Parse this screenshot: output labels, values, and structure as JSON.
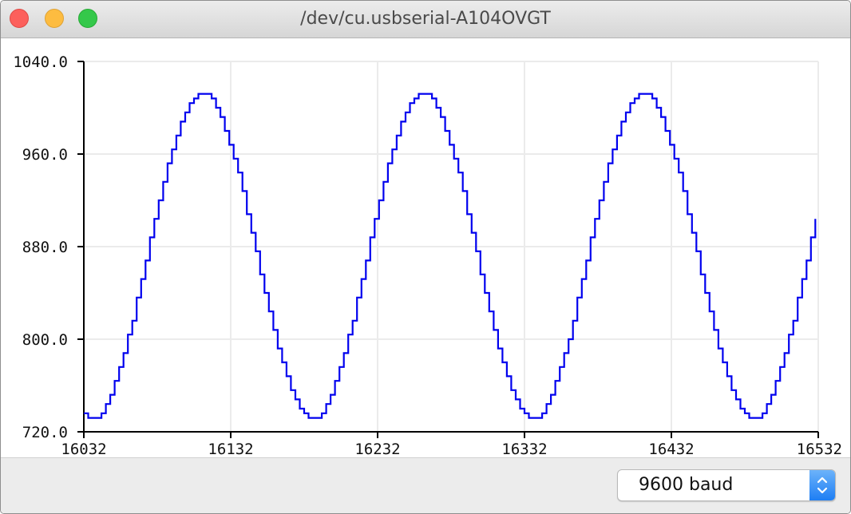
{
  "window": {
    "title": "/dev/cu.usbserial-A104OVGT"
  },
  "toolbar": {
    "baud_value": "9600 baud"
  },
  "icons": {
    "close": "close-traffic-light",
    "minimize": "minimize-traffic-light",
    "maximize": "maximize-traffic-light",
    "stepper": "select-stepper-icon"
  },
  "colors": {
    "line": "#0000ee",
    "grid": "#ebebeb",
    "axis": "#000000"
  },
  "chart_data": {
    "type": "line",
    "title": "",
    "xlabel": "",
    "ylabel": "",
    "xlim": [
      16032,
      16532
    ],
    "ylim": [
      720,
      1040
    ],
    "xticks": [
      16032,
      16132,
      16232,
      16332,
      16432,
      16532
    ],
    "yticks": [
      "720.0",
      "800.0",
      "880.0",
      "960.0",
      "1040.0"
    ],
    "grid": true,
    "series": [
      {
        "sine": {
          "center": 872,
          "amplitude": 140,
          "period": 150,
          "peak_x": 16112
        },
        "step": 3,
        "x_start": 16032,
        "x_end": 16532
      }
    ]
  }
}
